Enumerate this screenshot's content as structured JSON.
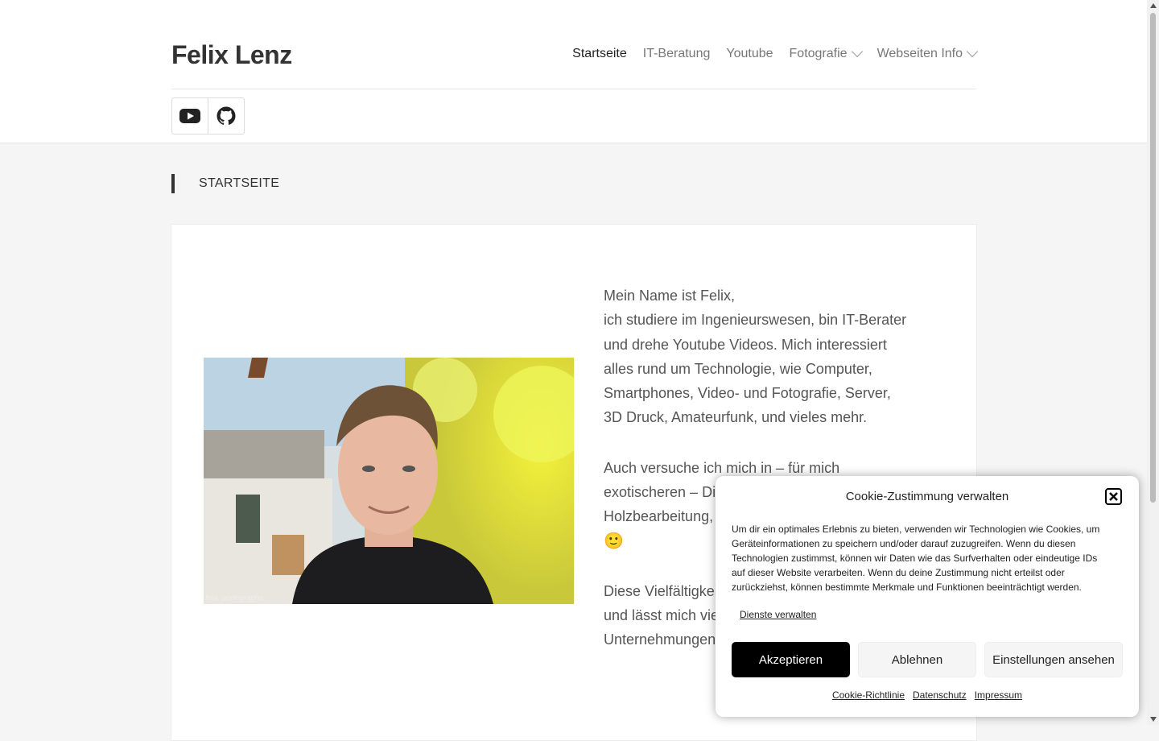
{
  "site": {
    "title": "Felix Lenz"
  },
  "nav": {
    "items": [
      {
        "label": "Startseite",
        "active": true,
        "has_dropdown": false
      },
      {
        "label": "IT-Beratung",
        "active": false,
        "has_dropdown": false
      },
      {
        "label": "Youtube",
        "active": false,
        "has_dropdown": false
      },
      {
        "label": "Fotografie",
        "active": false,
        "has_dropdown": true
      },
      {
        "label": "Webseiten Info",
        "active": false,
        "has_dropdown": true
      }
    ]
  },
  "social": {
    "icons": [
      "youtube-icon",
      "github-icon"
    ]
  },
  "page": {
    "heading": "STARTSEITE"
  },
  "content": {
    "photo_watermark": "felix_photographs_",
    "paragraphs": [
      "Mein Name ist Felix,\nich studiere im Ingenieurswesen, bin IT-Berater\nund drehe Youtube Videos. Mich interessiert\nalles rund um Technologie, wie Computer,\nSmartphones, Video- und Fotografie, Server,\n3D Druck, Amateurfunk, und vieles mehr.",
      "Auch versuche ich mich in – für mich\nexotischeren – Disziplinen wie Gärtnern,\nHolzbearbeitung, Musik oder Gemüsegärtnern",
      "Diese Vielfältigkeit\nund lässt mich vie\nUnternehmungen"
    ],
    "emoji": "🙂"
  },
  "cookie": {
    "title": "Cookie-Zustimmung verwalten",
    "text": "Um dir ein optimales Erlebnis zu bieten, verwenden wir Technologien wie Cookies, um Geräteinformationen zu speichern und/oder darauf zuzugreifen. Wenn du diesen Technologien zustimmst, können wir Daten wie das Surfverhalten oder eindeutige IDs auf dieser Website verarbeiten. Wenn du deine Zustimmung nicht erteilst oder zurückziehst, können bestimmte Merkmale und Funktionen beeinträchtigt werden.",
    "manage_label": "Dienste verwalten",
    "accept_label": "Akzeptieren",
    "deny_label": "Ablehnen",
    "settings_label": "Einstellungen ansehen",
    "links": [
      "Cookie-Richtlinie",
      "Datenschutz",
      "Impressum"
    ]
  },
  "colors": {
    "accept_bg": "#000000",
    "accent": "#333333"
  }
}
